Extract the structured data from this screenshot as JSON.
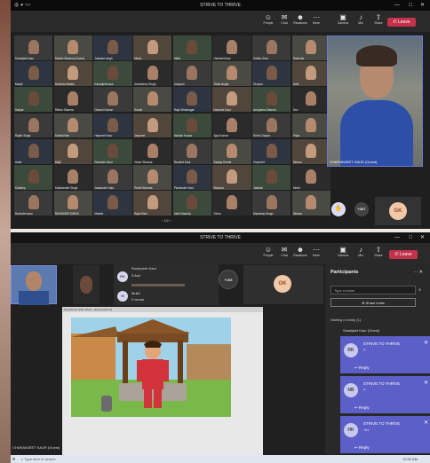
{
  "top_window": {
    "title": "STRIVE TO THRIVE",
    "controls": [
      "—",
      "□",
      "✕"
    ],
    "toolbar": [
      {
        "label": "People",
        "icon": "people-icon",
        "glyph": "☺"
      },
      {
        "label": "Chat",
        "icon": "chat-icon",
        "glyph": "✉"
      },
      {
        "label": "Reactions",
        "icon": "reactions-icon",
        "glyph": "☻"
      },
      {
        "label": "More",
        "icon": "more-icon",
        "glyph": "⋯"
      },
      {
        "label": "Camera",
        "icon": "camera-icon",
        "glyph": "▣"
      },
      {
        "label": "Mic",
        "icon": "mic-icon",
        "glyph": "♪"
      },
      {
        "label": "Share",
        "icon": "share-icon",
        "glyph": "⇧"
      }
    ],
    "leave_label": "Leave",
    "pager": "1/2",
    "participant_names": [
      "Kamaljeet kaur",
      "Sachin Sharma (Guest)",
      "Jaswant singh",
      "Nisha",
      "Akita",
      "Harmeet kaur",
      "Kritika Ghai",
      "Ravinder",
      "Manjit",
      "Harshita Bhatia",
      "Kamaljeet kaur",
      "Amandeep Singh",
      "Anupam",
      "Tania singla",
      "Divyani",
      "Amit",
      "Harpal",
      "Ritesh Sharma",
      "Dharmi Kumar",
      "Sonali",
      "Rajni Bhatnagar",
      "Navneet Kaur",
      "Anupama Sharma",
      "Dev",
      "Rajbir Singh",
      "Savita Rani",
      "Harpreet Kaur",
      "Jaspreet",
      "Manish Kumar",
      "Ajay Kumar",
      "Rohit Chopra",
      "Priya",
      "Anita",
      "Baljit",
      "Ravinder Kaur",
      "Varun Sharma",
      "Rameet Kaur",
      "Sanjay Kumar",
      "Gurpreet",
      "Meena",
      "Kuldeep",
      "Sukhwinder Singh",
      "Jaswinder Kaur",
      "Preeti Sharma",
      "Parminder Kaur",
      "Bhawna",
      "Jasleen",
      "Mohit",
      "Ravinder kaur",
      "RAVINDER SINGH",
      "Mamta",
      "Rajni Rani",
      "Jatin Dhanda",
      "Dhruv",
      "Mandeep Singh",
      "Simran"
    ],
    "featured_name": "CHARANJEET KAUR (Guest)",
    "badge_count": "+207",
    "self_avatar": "GK"
  },
  "bottom_window": {
    "title": "STRIVE TO THRIVE",
    "controls": [
      "—",
      "□",
      "✕"
    ],
    "toolbar": [
      {
        "label": "People",
        "icon": "people-icon",
        "glyph": "☺"
      },
      {
        "label": "Chat",
        "icon": "chat-icon",
        "glyph": "✉"
      },
      {
        "label": "Reactions",
        "icon": "reactions-icon",
        "glyph": "☻"
      },
      {
        "label": "More",
        "icon": "more-icon",
        "glyph": "⋯"
      },
      {
        "label": "Camera",
        "icon": "camera-icon",
        "glyph": "▣"
      },
      {
        "label": "Mic",
        "icon": "mic-icon",
        "glyph": "♪"
      },
      {
        "label": "Share",
        "icon": "share-icon",
        "glyph": "⇧"
      }
    ],
    "leave_label": "Leave",
    "speakers": [
      {
        "initials": "RK",
        "name": "Rushpreet Kaur",
        "sub": "3 Ash"
      },
      {
        "initials": "M",
        "name": "Mukti",
        "sub": "2 words"
      }
    ],
    "raise_count": "+193",
    "self_avatar": "GK",
    "presenter_name": "CHARANJEET KAUR (Guest)",
    "slide_title": "PowerPoint Slide Show - [Presentation1]",
    "participants_panel": {
      "title": "Participants",
      "search_placeholder": "Type a name",
      "share_invite": "Share invite",
      "lobby_label": "Waiting in lobby (1)",
      "lobby_person": "Sarabjeet Kaur (Guest)"
    },
    "notifications": [
      {
        "initials": "RK",
        "title": "STRIVE TO THRIVE",
        "message": "P",
        "reply": "Reply"
      },
      {
        "initials": "NB",
        "title": "STRIVE TO THRIVE",
        "message": "P",
        "reply": "Reply"
      },
      {
        "initials": "HK",
        "title": "STRIVE TO THRIVE",
        "message": "Yes",
        "reply": "Reply"
      }
    ],
    "taskbar": {
      "search": "Type here to search",
      "time": "10:32 AM"
    }
  },
  "colors": {
    "leave": "#c4314b",
    "notification": "#5b5fc7",
    "dark": "#1f1f1f",
    "accent_orange": "#e8a56b"
  }
}
